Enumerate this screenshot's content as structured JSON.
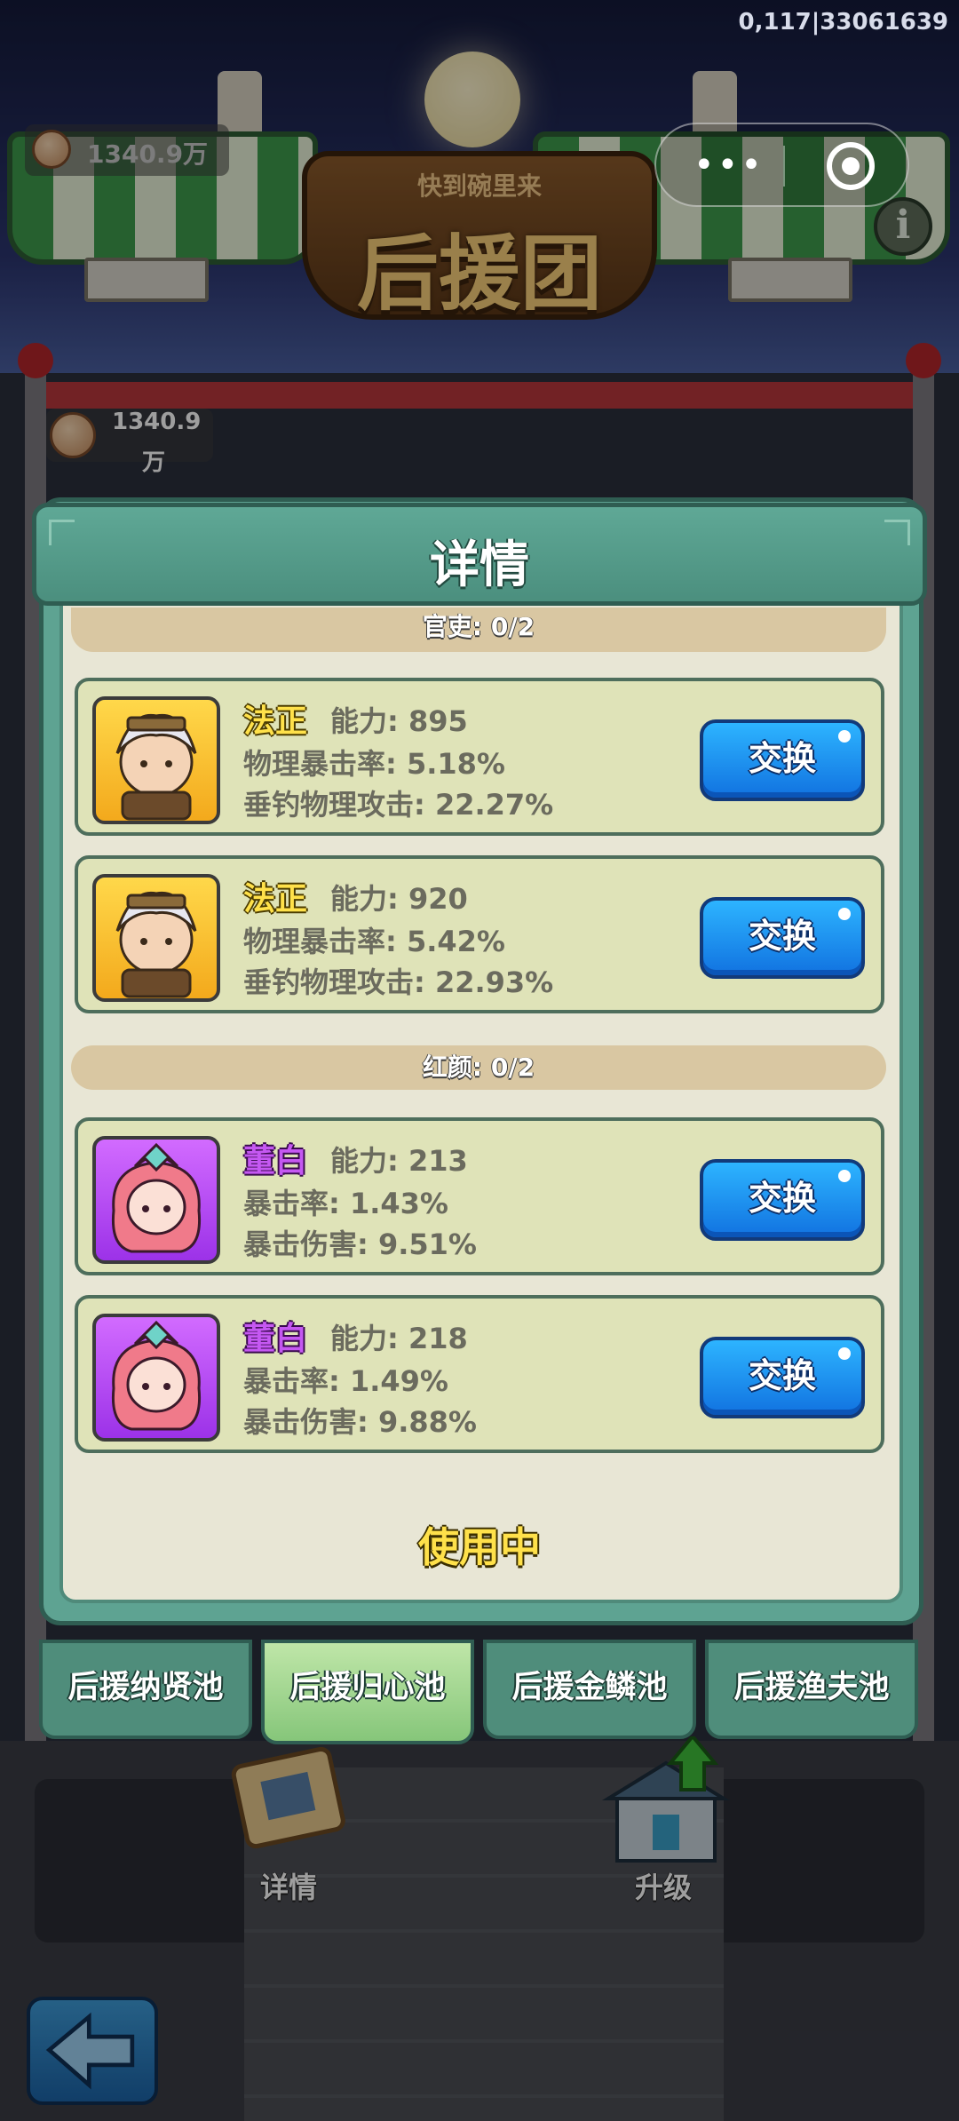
{
  "status": {
    "coord": "0,117|33061639"
  },
  "banner": {
    "subtitle": "快到碗里来",
    "title": "后援团"
  },
  "currency": {
    "top_amount": "1340.9万",
    "side_amount_line1": "1340.9",
    "side_amount_line2": "万"
  },
  "capsule": {
    "more": "•••"
  },
  "info_icon": "i",
  "modal": {
    "title": "详情",
    "sections": [
      {
        "label": "官吏: 0/2",
        "cards": [
          {
            "name": "法正",
            "power": "能力: 895",
            "stat1": "物理暴击率: 5.18%",
            "stat2": "垂钓物理攻击: 22.27%",
            "button": "交换",
            "rarity_color": "#f3a91c"
          },
          {
            "name": "法正",
            "power": "能力: 920",
            "stat1": "物理暴击率: 5.42%",
            "stat2": "垂钓物理攻击: 22.93%",
            "button": "交换",
            "rarity_color": "#f3a91c"
          }
        ]
      },
      {
        "label": "红颜: 0/2",
        "cards": [
          {
            "name": "董白",
            "power": "能力: 213",
            "stat1": "暴击率: 1.43%",
            "stat2": "暴击伤害: 9.51%",
            "button": "交换",
            "rarity_color": "#9c32e8"
          },
          {
            "name": "董白",
            "power": "能力: 218",
            "stat1": "暴击率: 1.49%",
            "stat2": "暴击伤害: 9.88%",
            "button": "交换",
            "rarity_color": "#9c32e8"
          }
        ]
      }
    ],
    "status": "使用中"
  },
  "tabs": [
    {
      "label": "后援纳贤池",
      "active": false
    },
    {
      "label": "后援归心池",
      "active": true
    },
    {
      "label": "后援金鳞池",
      "active": false
    },
    {
      "label": "后援渔夫池",
      "active": false
    }
  ],
  "bottom": {
    "details_label": "详情",
    "upgrade_label": "升级"
  },
  "icons": {
    "back": "back-arrow-icon",
    "details": "scroll-icon",
    "upgrade": "building-upgrade-icon",
    "coin": "coin-icon"
  }
}
